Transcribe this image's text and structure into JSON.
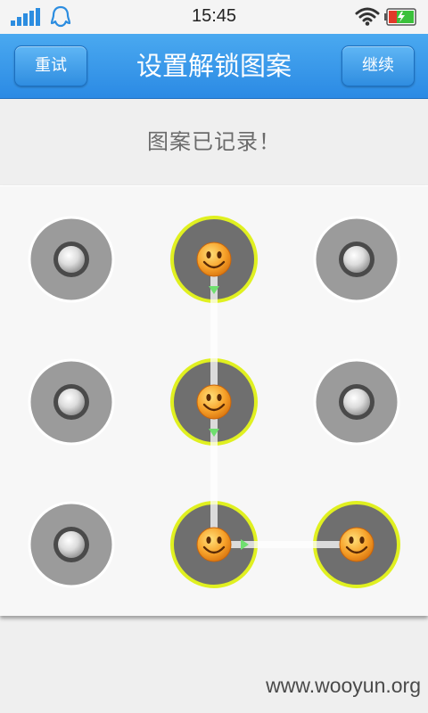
{
  "status_bar": {
    "time": "15:45",
    "icons": [
      "signal-bars-icon",
      "qq-penguin-icon",
      "wifi-icon",
      "battery-charging-icon"
    ]
  },
  "title_bar": {
    "title": "设置解锁图案",
    "left_button": "重试",
    "right_button": "继续"
  },
  "message": "图案已记录！",
  "pattern": {
    "grid": [
      "r1c1",
      "r1c2",
      "r1c3",
      "r2c1",
      "r2c2",
      "r2c3",
      "r3c1",
      "r3c2",
      "r3c3"
    ],
    "selected_nodes": [
      "r1c2",
      "r2c2",
      "r3c2",
      "r3c3"
    ],
    "selected_icon": "smiley-face-icon",
    "unselected_icon": "ring-dot-icon"
  },
  "colors": {
    "title_bar": "#2f8fe6",
    "node_ring": "#e0f020",
    "node_fill": "#6f6f6f",
    "path_line": "#ffffff",
    "arrow": "#6fe06f"
  },
  "watermark": "www.wooyun.org"
}
